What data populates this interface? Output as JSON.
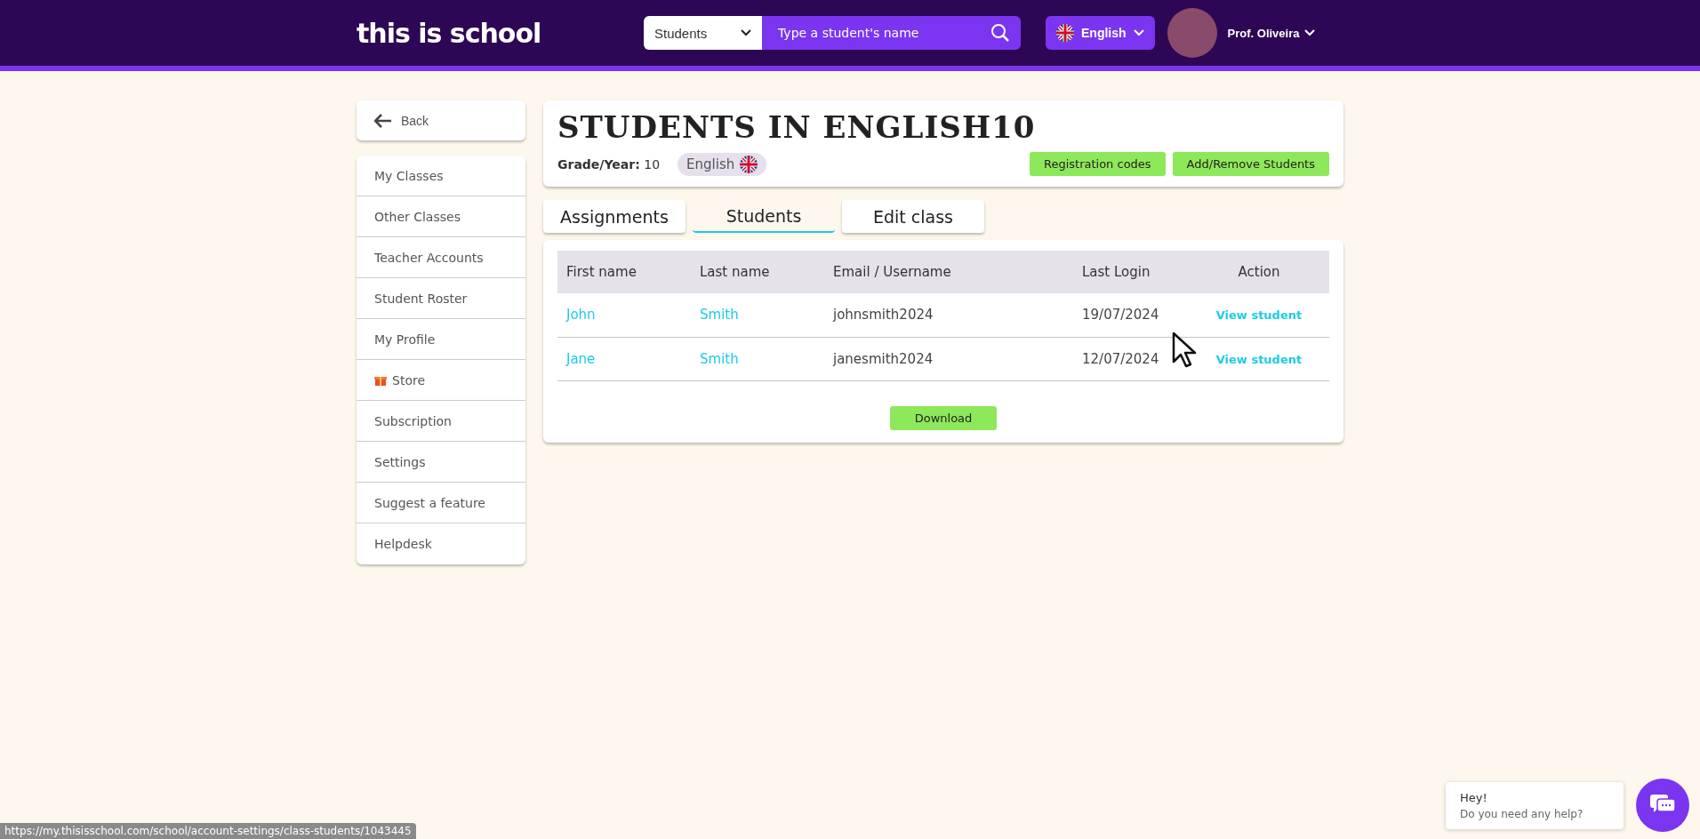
{
  "header": {
    "logo": "this is school",
    "search": {
      "scope": "Students",
      "placeholder": "Type a student's name"
    },
    "language": "English",
    "user": "Prof. Oliveira"
  },
  "sidebar": {
    "back": "Back",
    "items": [
      {
        "label": "My Classes",
        "kind": "plain"
      },
      {
        "label": "Other Classes",
        "kind": "plain"
      },
      {
        "label": "Teacher Accounts",
        "kind": "plain"
      },
      {
        "label": "Student Roster",
        "kind": "plain"
      },
      {
        "label": "My Profile",
        "kind": "plain"
      },
      {
        "label": "Store",
        "kind": "gift"
      },
      {
        "label": "Subscription",
        "kind": "plain"
      },
      {
        "label": "Settings",
        "kind": "plain"
      },
      {
        "label": "Suggest a feature",
        "kind": "plain"
      },
      {
        "label": "Helpdesk",
        "kind": "plain"
      }
    ]
  },
  "class": {
    "title": "STUDENTS IN ENGLISH10",
    "grade_label": "Grade/Year:",
    "grade": "10",
    "subject": "English",
    "buttons": [
      "Registration codes",
      "Add/Remove Students"
    ]
  },
  "tabs": [
    {
      "label": "Assignments",
      "selected": false
    },
    {
      "label": "Students",
      "selected": true
    },
    {
      "label": "Edit class",
      "selected": false
    }
  ],
  "table": {
    "columns": [
      "First name",
      "Last name",
      "Email / Username",
      "Last Login",
      "Action"
    ],
    "rows": [
      {
        "first": "John",
        "last": "Smith",
        "email": "johnsmith2024",
        "login": "19/07/2024",
        "action": "View student"
      },
      {
        "first": "Jane",
        "last": "Smith",
        "email": "janesmith2024",
        "login": "12/07/2024",
        "action": "View student"
      }
    ]
  },
  "download": "Download",
  "status_url": "https://my.thisisschool.com/school/account-settings/class-students/1043445",
  "chat": {
    "title": "Hey!",
    "text": "Do you need any help?"
  }
}
